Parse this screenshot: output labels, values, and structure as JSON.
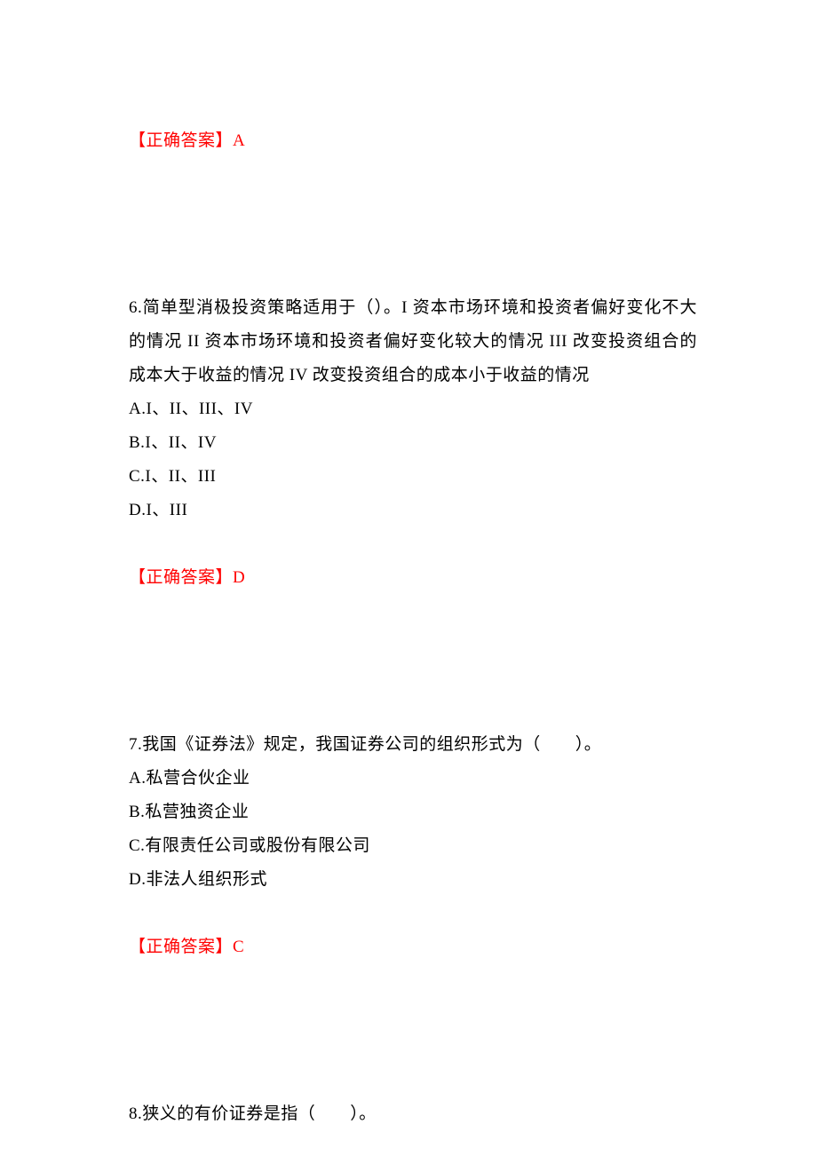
{
  "answer5": {
    "label": "【正确答案】",
    "letter": "A"
  },
  "question6": {
    "stem": "6.简单型消极投资策略适用于（）。I 资本市场环境和投资者偏好变化不大的情况 II 资本市场环境和投资者偏好变化较大的情况 III 改变投资组合的成本大于收益的情况 IV 改变投资组合的成本小于收益的情况",
    "optionA": "A.I、II、III、IV",
    "optionB": "B.I、II、IV",
    "optionC": "C.I、II、III",
    "optionD": "D.I、III",
    "answerLabel": "【正确答案】",
    "answerLetter": "D"
  },
  "question7": {
    "stem": "7.我国《证券法》规定，我国证券公司的组织形式为（　　）。",
    "optionA": "A.私营合伙企业",
    "optionB": "B.私营独资企业",
    "optionC": "C.有限责任公司或股份有限公司",
    "optionD": "D.非法人组织形式",
    "answerLabel": "【正确答案】",
    "answerLetter": "C"
  },
  "question8": {
    "stem": "8.狭义的有价证券是指（　　）。"
  }
}
